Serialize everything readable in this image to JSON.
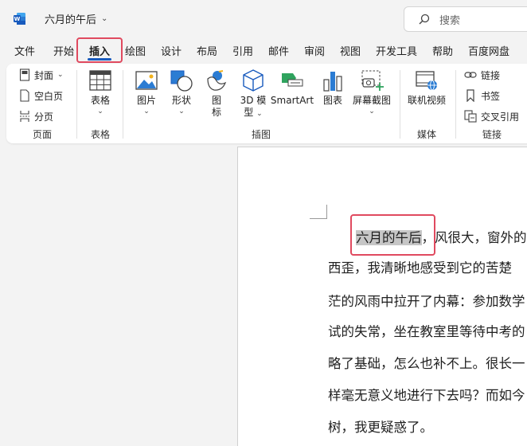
{
  "titlebar": {
    "app_icon": "word-icon",
    "doc_title": "六月的午后",
    "search_placeholder": "搜索"
  },
  "tabs": [
    {
      "label": "文件"
    },
    {
      "label": "开始"
    },
    {
      "label": "插入",
      "active": true
    },
    {
      "label": "绘图"
    },
    {
      "label": "设计"
    },
    {
      "label": "布局"
    },
    {
      "label": "引用"
    },
    {
      "label": "邮件"
    },
    {
      "label": "审阅"
    },
    {
      "label": "视图"
    },
    {
      "label": "开发工具"
    },
    {
      "label": "帮助"
    },
    {
      "label": "百度网盘"
    }
  ],
  "ribbon": {
    "pages_group": {
      "label": "页面",
      "cover": "封面",
      "blank_page": "空白页",
      "page_break": "分页"
    },
    "tables_group": {
      "label": "表格",
      "table": "表格"
    },
    "illustrations_group": {
      "label": "插图",
      "pictures": "图片",
      "shapes": "形状",
      "icons_1": "图",
      "icons_2": "标",
      "models_1": "3D 模",
      "models_2": "型",
      "smartart": "SmartArt",
      "chart": "图表",
      "screenshot": "屏幕截图"
    },
    "media_group": {
      "label": "媒体",
      "online_video": "联机视频"
    },
    "links_group": {
      "label": "链接",
      "link": "链接",
      "bookmark": "书签",
      "cross_reference": "交叉引用"
    }
  },
  "document": {
    "selected_text": "六月的午后",
    "line1_rest": "，风很大，窗外的",
    "lines": [
      "西歪，我清晰地感受到它的苦楚",
      "茫的风雨中拉开了内幕：参加数学",
      "试的失常，坐在教室里等待中考的",
      "略了基础，怎么也补不上。很长一",
      "样毫无意义地进行下去吗？而如今",
      "树，我更疑惑了。"
    ]
  },
  "colors": {
    "accent": "#185abd",
    "highlight_box": "#e04a5f",
    "selection": "#c6c6c6"
  }
}
